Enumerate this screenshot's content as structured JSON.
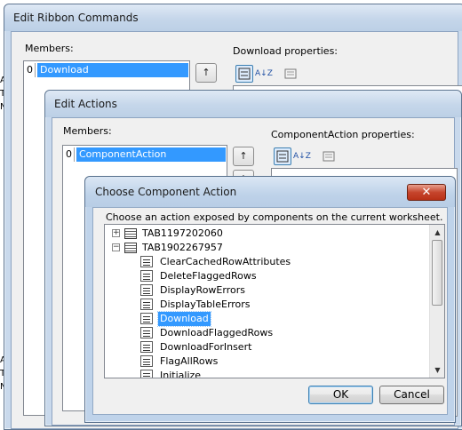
{
  "ribbon_dialog": {
    "title": "Edit Ribbon Commands",
    "members_label": "Members:",
    "members": [
      {
        "index": "0",
        "label": "Download"
      }
    ],
    "properties_label": "Download properties:",
    "up_arrow": "↑"
  },
  "actions_dialog": {
    "title": "Edit Actions",
    "members_label": "Members:",
    "members": [
      {
        "index": "0",
        "label": "ComponentAction"
      }
    ],
    "properties_label": "ComponentAction properties:",
    "up_arrow": "↑",
    "down_arrow": "↓"
  },
  "choose_dialog": {
    "title": "Choose Component Action",
    "close_glyph": "✕",
    "prompt": "Choose an action exposed by components on the current worksheet.",
    "tree": [
      {
        "label": "TAB1197202060",
        "level": 0,
        "expander": "+",
        "icon": "table-icon"
      },
      {
        "label": "TAB1902267957",
        "level": 0,
        "expander": "−",
        "icon": "table-icon"
      },
      {
        "label": "ClearCachedRowAttributes",
        "level": 1,
        "icon": "action-icon"
      },
      {
        "label": "DeleteFlaggedRows",
        "level": 1,
        "icon": "action-icon"
      },
      {
        "label": "DisplayRowErrors",
        "level": 1,
        "icon": "action-icon"
      },
      {
        "label": "DisplayTableErrors",
        "level": 1,
        "icon": "action-icon"
      },
      {
        "label": "Download",
        "level": 1,
        "icon": "action-icon",
        "selected": true
      },
      {
        "label": "DownloadFlaggedRows",
        "level": 1,
        "icon": "action-icon"
      },
      {
        "label": "DownloadForInsert",
        "level": 1,
        "icon": "action-icon"
      },
      {
        "label": "FlagAllRows",
        "level": 1,
        "icon": "action-icon"
      },
      {
        "label": "Initialize",
        "level": 1,
        "icon": "action-icon"
      }
    ],
    "ok_label": "OK",
    "cancel_label": "Cancel"
  },
  "sort_az_glyph": "A↓Z"
}
